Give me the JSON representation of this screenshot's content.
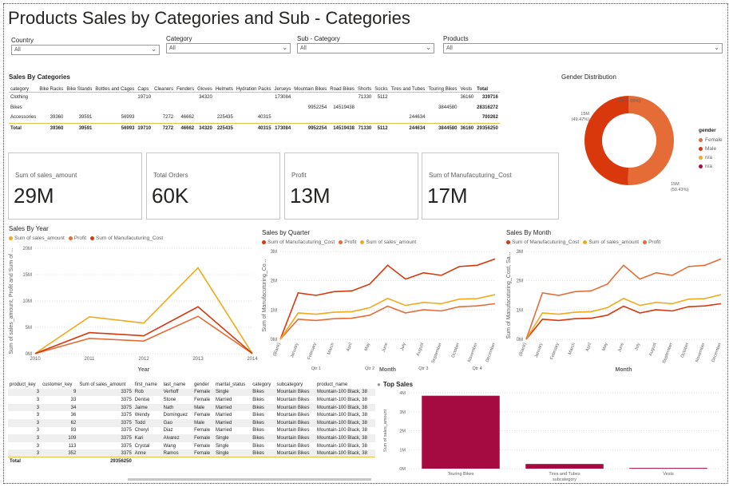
{
  "page_title": "Products Sales by Categories and Sub - Categories",
  "slicers": [
    {
      "label": "Country",
      "value": "All"
    },
    {
      "label": "Category",
      "value": "All"
    },
    {
      "label": "Sub - Category",
      "value": "All"
    },
    {
      "label": "Products",
      "value": "All"
    }
  ],
  "matrix": {
    "title": "Sales By Categories",
    "columns": [
      "category",
      "Bike Racks",
      "Bike Stands",
      "Bottles and Cages",
      "Caps",
      "Cleaners",
      "Fenders",
      "Gloves",
      "Helmets",
      "Hydration Packs",
      "Jerseys",
      "Mountain Bikes",
      "Road Bikes",
      "Shorts",
      "Socks",
      "Tires and Tubes",
      "Touring Bikes",
      "Vests",
      "Total"
    ],
    "rows": [
      [
        "Clothing",
        "",
        "",
        "",
        "19710",
        "",
        "",
        "34320",
        "",
        "",
        "173084",
        "",
        "",
        "71330",
        "5112",
        "",
        "",
        "36160",
        "339716"
      ],
      [
        "Bikes",
        "",
        "",
        "",
        "",
        "",
        "",
        "",
        "",
        "",
        "",
        "9952254",
        "14519438",
        "",
        "",
        "",
        "3844580",
        "",
        "28316272"
      ],
      [
        "Accessories",
        "39360",
        "39591",
        "56993",
        "",
        "7272",
        "46662",
        "",
        "225435",
        "40315",
        "",
        "",
        "",
        "",
        "",
        "244634",
        "",
        "",
        "700262"
      ],
      [
        "Total",
        "39360",
        "39591",
        "56993",
        "19710",
        "7272",
        "46662",
        "34320",
        "225435",
        "40315",
        "173084",
        "9952254",
        "14519438",
        "71330",
        "5112",
        "244634",
        "3844580",
        "36160",
        "29356250"
      ]
    ]
  },
  "gender_chart": {
    "title": "Gender Distribution",
    "legend_title": "gender",
    "labels": {
      "top": "0M (0.09%)",
      "left_1": "15M",
      "left_2": "(49.47%)",
      "right_1": "15M",
      "right_2": "(50.43%)"
    },
    "legend": [
      {
        "name": "Female",
        "color": "#E66C37"
      },
      {
        "name": "Male",
        "color": "#D9370C"
      },
      {
        "name": "n/a",
        "color": "#F2A91C"
      },
      {
        "name": "n/a",
        "color": "#B1064A"
      }
    ]
  },
  "cards": [
    {
      "label": "Sum of sales_amount",
      "value": "29M"
    },
    {
      "label": "Total Orders",
      "value": "60K"
    },
    {
      "label": "Profit",
      "value": "13M"
    },
    {
      "label": "Sum of Manufacuturing_Cost",
      "value": "17M"
    }
  ],
  "colors": {
    "sales": "#F2A91C",
    "profit": "#E66C37",
    "cost": "#D9370C",
    "bar": "#A50B41"
  },
  "year_chart": {
    "title": "Sales By Year",
    "legend": [
      "Sum of sales_amount",
      "Profit",
      "Sum of Manufacuturing_Cost"
    ],
    "ylabel": "Sum of sales_amount, Profit and Sum of ...",
    "xlabel": "Year"
  },
  "quarter_chart": {
    "title": "Sales by Quarter",
    "legend": [
      "Sum of Manufacuturing_Cost",
      "Profit",
      "Sum of sales_amount"
    ],
    "ylabel": "Sum of Manufacuturing_Co...",
    "xlabel": "Month",
    "quarters": [
      "Qtr 1",
      "Qtr 2",
      "Qtr 3",
      "Qtr 4"
    ]
  },
  "month_chart": {
    "title": "Sales By Month",
    "legend": [
      "Sum of Manufacuturing_Cost",
      "Sum of sales_amount",
      "Profit"
    ],
    "ylabel": "Sum of Manufacuturing_Cost, Sa...",
    "xlabel": "Month"
  },
  "detail_table": {
    "columns": [
      "product_key",
      "customer_key",
      "Sum of sales_amount",
      "first_name",
      "last_name",
      "gender",
      "marital_status",
      "category",
      "subcategory",
      "product_name"
    ],
    "rows": [
      [
        "3",
        "9",
        "3375",
        "Rob",
        "Verhoff",
        "Female",
        "Single",
        "Bikes",
        "Mountain Bikes",
        "Mountain-100 Black, 38"
      ],
      [
        "3",
        "33",
        "3375",
        "Denise",
        "Stone",
        "Female",
        "Married",
        "Bikes",
        "Mountain Bikes",
        "Mountain-100 Black, 38"
      ],
      [
        "3",
        "34",
        "3375",
        "Jaime",
        "Nath",
        "Male",
        "Married",
        "Bikes",
        "Mountain Bikes",
        "Mountain-100 Black, 38"
      ],
      [
        "3",
        "36",
        "3375",
        "Wendy",
        "Dominguez",
        "Female",
        "Married",
        "Bikes",
        "Mountain Bikes",
        "Mountain-100 Black, 38"
      ],
      [
        "3",
        "62",
        "3375",
        "Todd",
        "Gao",
        "Male",
        "Married",
        "Bikes",
        "Mountain Bikes",
        "Mountain-100 Black, 38"
      ],
      [
        "3",
        "93",
        "3375",
        "Cheryl",
        "Diaz",
        "Female",
        "Married",
        "Bikes",
        "Mountain Bikes",
        "Mountain-100 Black, 38"
      ],
      [
        "3",
        "109",
        "3375",
        "Kari",
        "Alvarez",
        "Female",
        "Single",
        "Bikes",
        "Mountain Bikes",
        "Mountain-100 Black, 38"
      ],
      [
        "3",
        "113",
        "3375",
        "Crystal",
        "Wang",
        "Female",
        "Single",
        "Bikes",
        "Mountain Bikes",
        "Mountain-100 Black, 38"
      ],
      [
        "3",
        "352",
        "3375",
        "Anne",
        "Ramos",
        "Female",
        "Single",
        "Bikes",
        "Mountain Bikes",
        "Mountain-100 Black, 38"
      ]
    ],
    "total_label": "Total",
    "total_value": "29356250"
  },
  "chart_data": [
    {
      "type": "line",
      "title": "Sales By Year",
      "xlabel": "Year",
      "ylabel": "Sum of sales_amount, Profit and Sum of ...",
      "x": [
        "2010",
        "2011",
        "2012",
        "2013",
        "2014"
      ],
      "y_ticks": [
        "0M",
        "5M",
        "10M",
        "15M",
        "20M"
      ],
      "ylim": [
        0,
        20
      ],
      "series": [
        {
          "name": "Sum of sales_amount",
          "color": "#F2A91C",
          "values": [
            0.04,
            7.0,
            5.8,
            16.3,
            0.05
          ]
        },
        {
          "name": "Profit",
          "color": "#E66C37",
          "values": [
            0.02,
            2.9,
            2.4,
            7.1,
            0.02
          ]
        },
        {
          "name": "Sum of Manufacuturing_Cost",
          "color": "#D9370C",
          "values": [
            0.02,
            4.0,
            3.4,
            8.9,
            0.03
          ]
        }
      ]
    },
    {
      "type": "line",
      "title": "Sales by Quarter",
      "xlabel": "Month",
      "ylabel": "Sum of Manufacuturing_Co...",
      "x": [
        "(Blank)",
        "January",
        "February",
        "March",
        "April",
        "May",
        "June",
        "July",
        "August",
        "September",
        "October",
        "November",
        "December"
      ],
      "y_ticks": [
        "0M",
        "1M",
        "2M",
        "3M"
      ],
      "ylim": [
        0,
        3.5
      ],
      "series": [
        {
          "name": "Sum of Manufacuturing_Cost",
          "color": "#D9370C",
          "values": [
            0.0,
            1.85,
            1.75,
            1.9,
            1.93,
            2.2,
            2.95,
            2.4,
            2.65,
            2.55,
            2.9,
            2.95,
            3.2
          ]
        },
        {
          "name": "Profit",
          "color": "#E66C37",
          "values": [
            0.0,
            0.8,
            0.75,
            0.82,
            0.84,
            0.96,
            1.32,
            1.05,
            1.18,
            1.13,
            1.3,
            1.33,
            1.42
          ]
        },
        {
          "name": "Sum of sales_amount",
          "color": "#F2A91C",
          "values": [
            0.0,
            1.05,
            1.0,
            1.08,
            1.1,
            1.26,
            1.63,
            1.35,
            1.47,
            1.42,
            1.6,
            1.62,
            1.78
          ]
        }
      ]
    },
    {
      "type": "line",
      "title": "Sales By Month",
      "xlabel": "Month",
      "ylabel": "Sum of Manufacuturing_Cost, Sa...",
      "x": [
        "(Blank)",
        "January",
        "February",
        "March",
        "April",
        "May",
        "June",
        "July",
        "August",
        "September",
        "October",
        "November",
        "December"
      ],
      "y_ticks": [
        "0M",
        "1M",
        "2M",
        "3M"
      ],
      "ylim": [
        0,
        3.5
      ],
      "series": [
        {
          "name": "Sum of Manufacuturing_Cost",
          "color": "#D9370C",
          "values": [
            0.0,
            0.8,
            0.75,
            0.82,
            0.84,
            0.96,
            1.32,
            1.05,
            1.18,
            1.13,
            1.3,
            1.33,
            1.42
          ]
        },
        {
          "name": "Sum of sales_amount",
          "color": "#F2A91C",
          "values": [
            0.0,
            1.05,
            1.0,
            1.08,
            1.1,
            1.26,
            1.63,
            1.35,
            1.47,
            1.42,
            1.6,
            1.62,
            1.78
          ]
        },
        {
          "name": "Profit",
          "color": "#E66C37",
          "values": [
            0.0,
            1.85,
            1.75,
            1.9,
            1.93,
            2.2,
            2.95,
            2.4,
            2.65,
            2.55,
            2.9,
            2.95,
            3.2
          ]
        }
      ]
    },
    {
      "type": "pie",
      "title": "Gender Distribution",
      "categories": [
        "Female",
        "Male",
        "n/a"
      ],
      "values": [
        50.43,
        49.47,
        0.09
      ],
      "colors": [
        "#E66C37",
        "#D9370C",
        "#F2A91C"
      ]
    },
    {
      "type": "bar",
      "title": "Top Sales",
      "xlabel": "subcategory",
      "ylabel": "Sum of sales_amount",
      "categories": [
        "Touring Bikes",
        "Tires and Tubes",
        "Vests"
      ],
      "values": [
        3844580,
        244634,
        36160
      ],
      "y_ticks": [
        "0M",
        "1M",
        "2M",
        "3M",
        "4M"
      ],
      "ylim": [
        0,
        4000000
      ],
      "color": "#A50B41"
    }
  ],
  "top_sales": {
    "title": "Top Sales",
    "ylabel": "Sum of sales_amount",
    "xlabel": "subcategory"
  }
}
